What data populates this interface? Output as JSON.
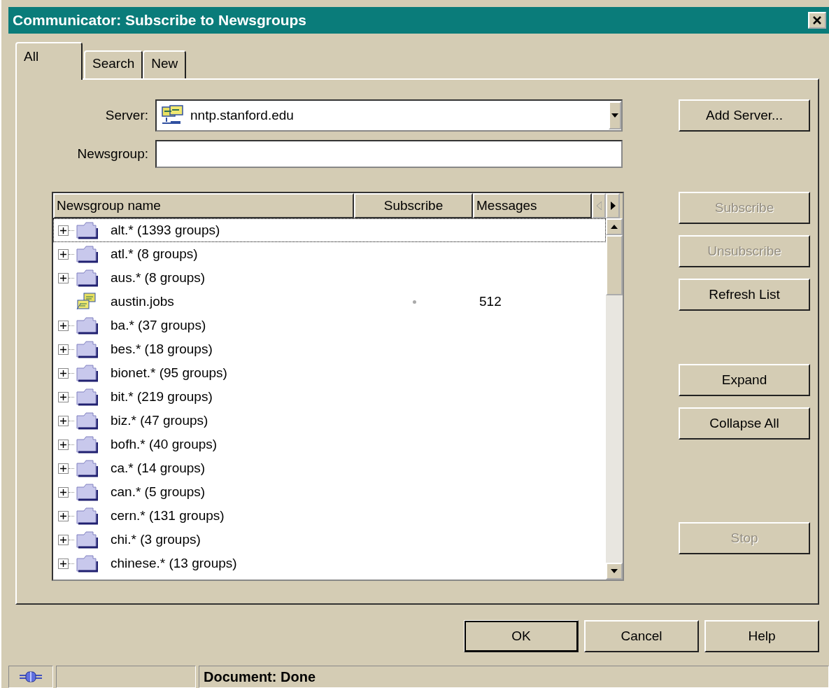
{
  "window": {
    "title": "Communicator: Subscribe to Newsgroups"
  },
  "tabs": [
    {
      "label": "All",
      "selected": true
    },
    {
      "label": "Search",
      "selected": false
    },
    {
      "label": "New",
      "selected": false
    }
  ],
  "server": {
    "label": "Server:",
    "value": "nntp.stanford.edu"
  },
  "newsgroup": {
    "label": "Newsgroup:"
  },
  "list": {
    "columns": [
      "Newsgroup name",
      "Subscribe",
      "Messages"
    ],
    "rows": [
      {
        "kind": "folder",
        "name": "alt.* (1393 groups)",
        "selected": true
      },
      {
        "kind": "folder",
        "name": "atl.* (8 groups)",
        "selected": false
      },
      {
        "kind": "folder",
        "name": "aus.* (8 groups)",
        "selected": false
      },
      {
        "kind": "group",
        "name": "austin.jobs",
        "subscribed": false,
        "messages": "512",
        "selected": false
      },
      {
        "kind": "folder",
        "name": "ba.* (37 groups)",
        "selected": false
      },
      {
        "kind": "folder",
        "name": "bes.* (18 groups)",
        "selected": false
      },
      {
        "kind": "folder",
        "name": "bionet.* (95 groups)",
        "selected": false
      },
      {
        "kind": "folder",
        "name": "bit.* (219 groups)",
        "selected": false
      },
      {
        "kind": "folder",
        "name": "biz.* (47 groups)",
        "selected": false
      },
      {
        "kind": "folder",
        "name": "bofh.* (40 groups)",
        "selected": false
      },
      {
        "kind": "folder",
        "name": "ca.* (14 groups)",
        "selected": false
      },
      {
        "kind": "folder",
        "name": "can.* (5 groups)",
        "selected": false
      },
      {
        "kind": "folder",
        "name": "cern.* (131 groups)",
        "selected": false
      },
      {
        "kind": "folder",
        "name": "chi.* (3 groups)",
        "selected": false
      },
      {
        "kind": "folder",
        "name": "chinese.* (13 groups)",
        "selected": false
      }
    ]
  },
  "side_buttons": [
    {
      "label": "Add Server...",
      "disabled": false
    },
    {
      "label": "Subscribe",
      "disabled": true
    },
    {
      "label": "Unsubscribe",
      "disabled": true
    },
    {
      "label": "Refresh List",
      "disabled": false
    },
    {
      "label": "Expand",
      "disabled": false
    },
    {
      "label": "Collapse All",
      "disabled": false
    },
    {
      "label": "Stop",
      "disabled": true
    }
  ],
  "dialog_buttons": [
    {
      "label": "OK",
      "default": true
    },
    {
      "label": "Cancel",
      "default": false
    },
    {
      "label": "Help",
      "default": false
    }
  ],
  "status_bar": {
    "text": "Document: Done"
  }
}
